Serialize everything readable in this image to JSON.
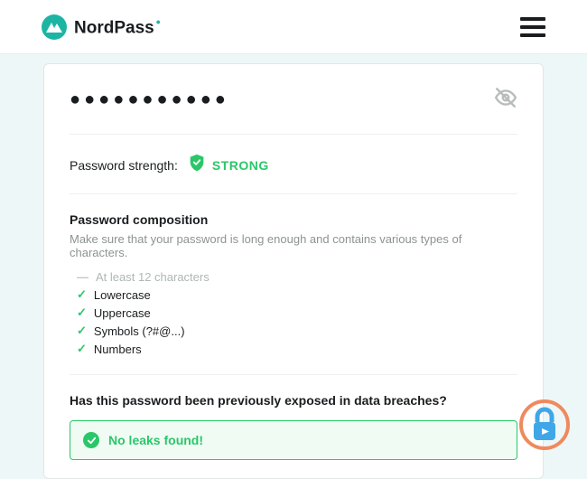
{
  "brand": {
    "name_a": "Nord",
    "name_b": "Pass"
  },
  "password_mask": "●●●●●●●●●●●",
  "strength": {
    "label": "Password strength:",
    "value": "STRONG"
  },
  "composition": {
    "title": "Password composition",
    "subtitle": "Make sure that your password is long enough and contains various types of characters.",
    "items": [
      {
        "label": "At least 12 characters",
        "met": false
      },
      {
        "label": "Lowercase",
        "met": true
      },
      {
        "label": "Uppercase",
        "met": true
      },
      {
        "label": "Symbols (?#@...)",
        "met": true
      },
      {
        "label": "Numbers",
        "met": true
      }
    ]
  },
  "breach": {
    "question": "Has this password been previously exposed in data breaches?",
    "result": "No leaks found!"
  }
}
